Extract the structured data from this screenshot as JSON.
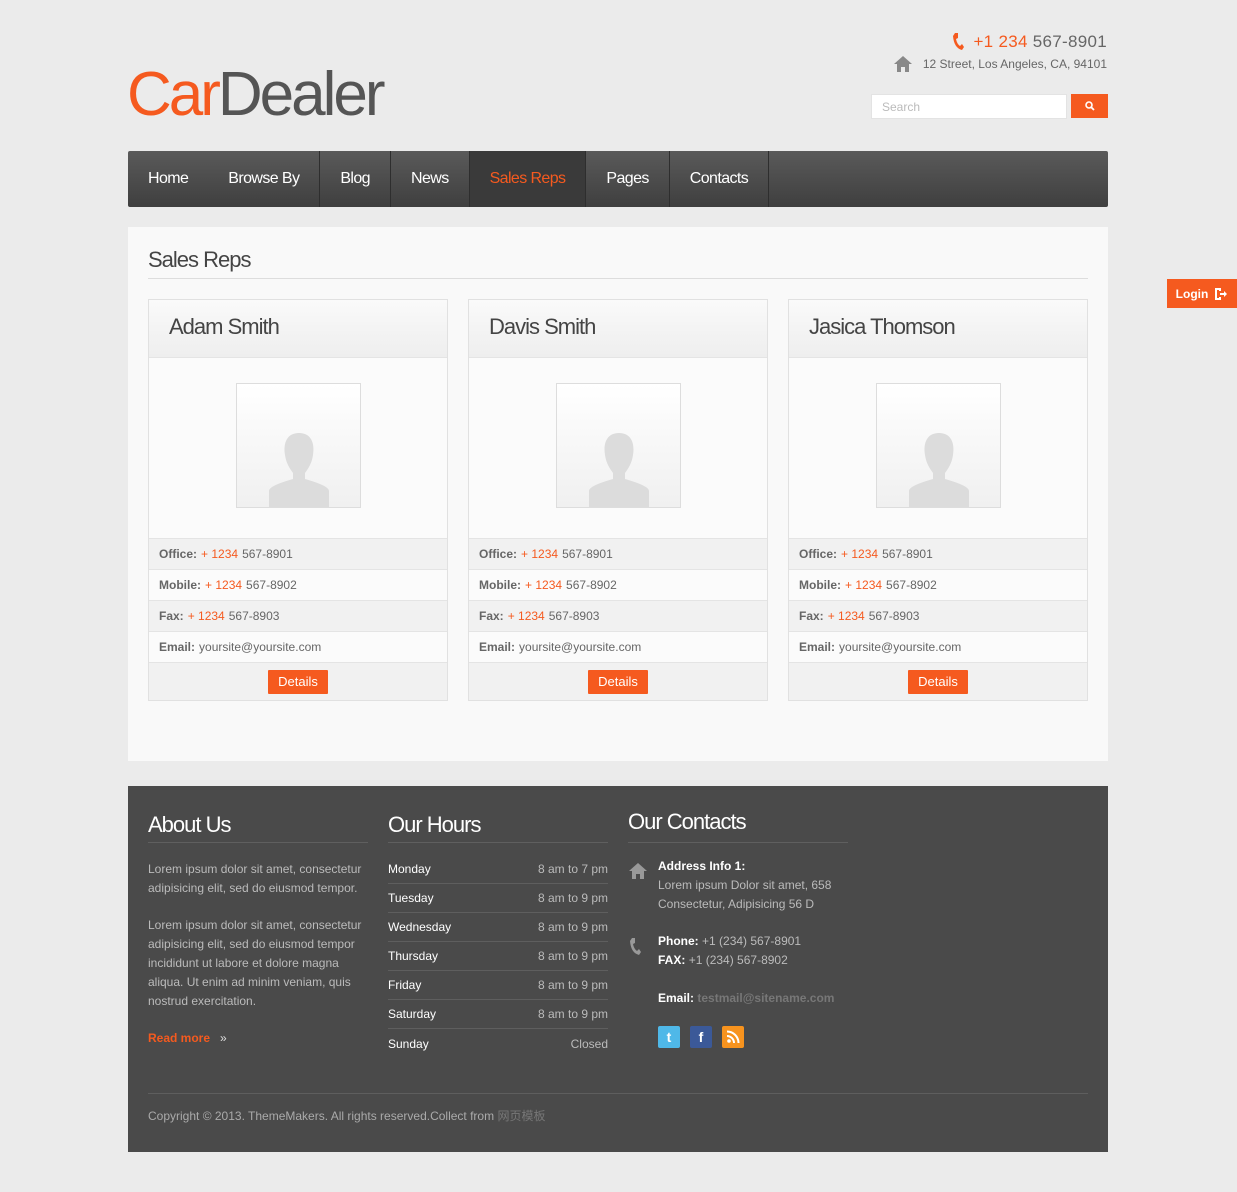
{
  "logo": {
    "part1": "Car",
    "part2": "Dealer"
  },
  "contact_top": {
    "phone_prefix": "+1 234",
    "phone_rest": "567-8901",
    "address": "12 Street, Los Angeles, CA, 94101"
  },
  "search": {
    "placeholder": "Search"
  },
  "nav": [
    {
      "label": "Home",
      "active": false
    },
    {
      "label": "Browse By",
      "active": false
    },
    {
      "label": "Blog",
      "active": false
    },
    {
      "label": "News",
      "active": false
    },
    {
      "label": "Sales Reps",
      "active": true
    },
    {
      "label": "Pages",
      "active": false
    },
    {
      "label": "Contacts",
      "active": false
    }
  ],
  "page_title": "Sales Reps",
  "login_label": "Login",
  "reps": [
    {
      "name": "Adam Smith"
    },
    {
      "name": "Davis Smith"
    },
    {
      "name": "Jasica Thomson"
    }
  ],
  "rep_fields": {
    "office_label": "Office:",
    "office_prefix": "+ 1234",
    "office_rest": "567-8901",
    "mobile_label": "Mobile:",
    "mobile_prefix": "+ 1234",
    "mobile_rest": "567-8902",
    "fax_label": "Fax:",
    "fax_prefix": "+ 1234",
    "fax_rest": "567-8903",
    "email_label": "Email:",
    "email": "yoursite@yoursite.com",
    "details_label": "Details"
  },
  "footer": {
    "about_title": "About Us",
    "about_p1": "Lorem ipsum dolor sit amet, consectetur adipisicing elit, sed do eiusmod tempor.",
    "about_p2": "Lorem ipsum dolor sit amet, consectetur adipisicing elit, sed do eiusmod tempor incididunt ut labore et dolore magna aliqua. Ut enim ad minim veniam, quis nostrud exercitation.",
    "read_more": "Read more",
    "hours_title": "Our Hours",
    "hours": [
      {
        "day": "Monday",
        "time": "8 am to 7 pm"
      },
      {
        "day": "Tuesday",
        "time": "8 am to 9 pm"
      },
      {
        "day": "Wednesday",
        "time": "8 am to 9 pm"
      },
      {
        "day": "Thursday",
        "time": "8 am to 9 pm"
      },
      {
        "day": "Friday",
        "time": "8 am to 9 pm"
      },
      {
        "day": "Saturday",
        "time": "8 am to 9 pm"
      },
      {
        "day": "Sunday",
        "time": "Closed"
      }
    ],
    "contacts_title": "Our Contacts",
    "address_label": "Address Info 1:",
    "address_line1": "Lorem ipsum Dolor sit amet, 658",
    "address_line2": "Consectetur, Adipisicing 56 D",
    "phone_label": "Phone:",
    "phone_value": "+1 (234) 567-8901",
    "fax_label": "FAX:",
    "fax_value": "+1 (234) 567-8902",
    "email_label": "Email:",
    "email_value": "testmail@sitename.com",
    "copyright": "Copyright © 2013. ThemeMakers. All rights reserved.Collect from",
    "copyright_link": "网页模板"
  },
  "colors": {
    "accent": "#f55a1f",
    "nav_bg": "#4a4a4a",
    "footer_bg": "#4a4a4a"
  }
}
